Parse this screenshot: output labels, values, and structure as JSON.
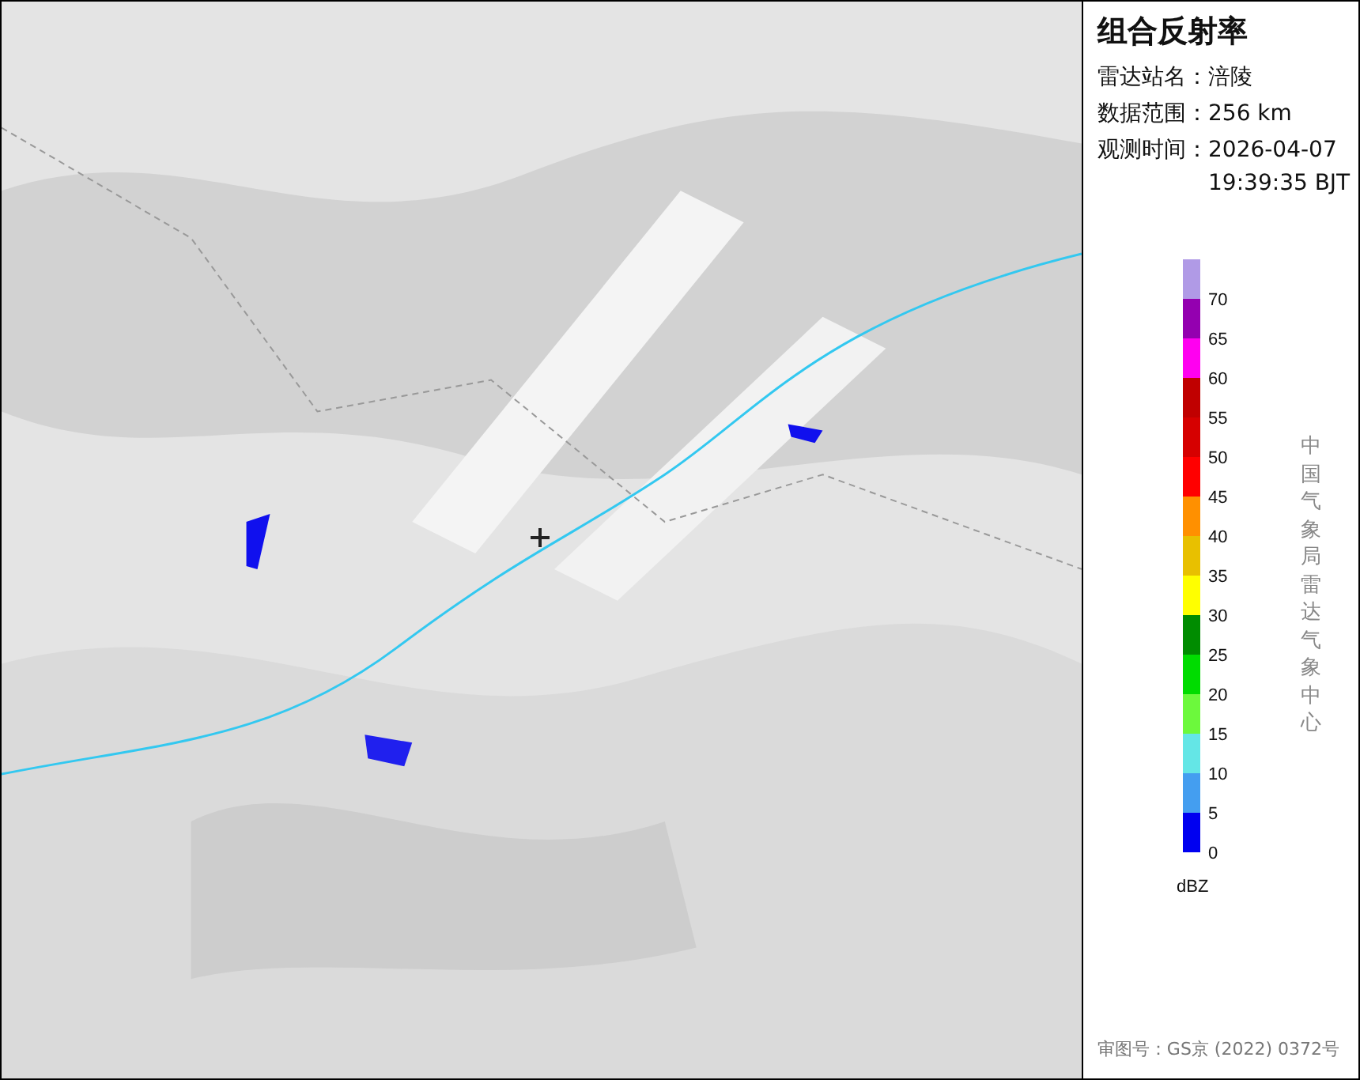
{
  "panel": {
    "title": "组合反射率",
    "info": [
      {
        "label": "雷达站名：",
        "value": "涪陵"
      },
      {
        "label": "数据范围：",
        "value": "256 km"
      },
      {
        "label": "观测时间：",
        "value": "2026-04-07 19:39:35 BJT"
      }
    ],
    "legend": {
      "unit": "dBZ",
      "steps": [
        {
          "color": "#b09ae6",
          "label": "70"
        },
        {
          "color": "#9400b0",
          "label": "65"
        },
        {
          "color": "#ff00f0",
          "label": "60"
        },
        {
          "color": "#c00000",
          "label": "55"
        },
        {
          "color": "#d60000",
          "label": "50"
        },
        {
          "color": "#ff0000",
          "label": "45"
        },
        {
          "color": "#ff9000",
          "label": "40"
        },
        {
          "color": "#e8c000",
          "label": "35"
        },
        {
          "color": "#ffff00",
          "label": "30"
        },
        {
          "color": "#008c00",
          "label": "25"
        },
        {
          "color": "#00dc00",
          "label": "20"
        },
        {
          "color": "#6cf93c",
          "label": "15"
        },
        {
          "color": "#64e6e6",
          "label": "10"
        },
        {
          "color": "#449ef0",
          "label": "5"
        },
        {
          "color": "#0000f0",
          "label": "0"
        }
      ]
    },
    "credit": "中国气象局雷达气象中心",
    "approval": "审图号：GS京 (2022) 0372号"
  }
}
